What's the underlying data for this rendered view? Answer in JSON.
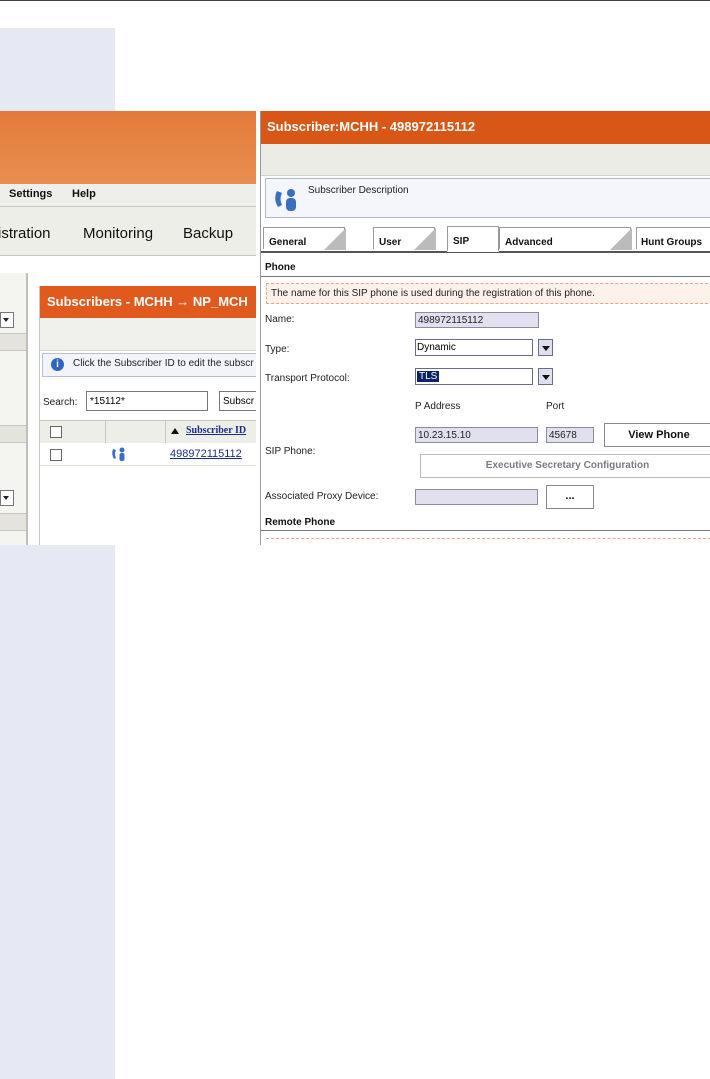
{
  "left_panel": {
    "menu": [
      "Settings",
      "Help"
    ],
    "nav": [
      "istration",
      "Monitoring",
      "Backup"
    ],
    "subscribers_header": "Subscribers - MCHH → NP_MCH",
    "info_text": "Click the Subscriber ID to edit the subscr",
    "search_label": "Search:",
    "search_value": "*15112*",
    "search_field": "Subscr",
    "column_subscriber_id": "Subscriber ID",
    "row_subscriber_id": "498972115112"
  },
  "right_panel": {
    "title": "Subscriber:MCHH - 498972115112",
    "description": "Subscriber Description",
    "tabs": [
      "General",
      "User",
      "SIP",
      "Advanced",
      "Hunt Groups"
    ],
    "active_tab": "SIP",
    "section_phone": "Phone",
    "hint": "The name for this SIP phone is used during the registration of this phone.",
    "name_label": "Name:",
    "name_value": "498972115112",
    "type_label": "Type:",
    "type_value": "Dynamic",
    "transport_label": "Transport Protocol:",
    "transport_value": "TLS",
    "ip_address_header": "P Address",
    "port_header": "Port",
    "sip_phone_label": "SIP Phone:",
    "ip_value": "10.23.15.10",
    "port_value": "45678",
    "view_phone_button": "View Phone",
    "exec_secretary_button": "Executive Secretary Configuration",
    "proxy_label": "Associated Proxy Device:",
    "proxy_button": "...",
    "section_remote": "Remote Phone"
  },
  "colors": {
    "accent_orange": "#d95716",
    "link_blue": "#1a2d8c",
    "side_strip": "#e6e9f3"
  }
}
